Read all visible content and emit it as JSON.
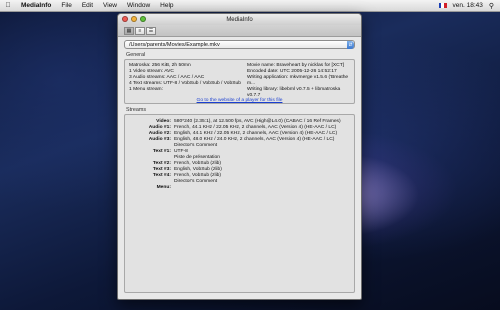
{
  "menubar": {
    "app_name": "MediaInfo",
    "items": [
      "File",
      "Edit",
      "View",
      "Window",
      "Help"
    ],
    "clock": "ven. 18:43",
    "flag_colors": [
      "#1a3fb5",
      "#ffffff",
      "#d2202a"
    ]
  },
  "window": {
    "title": "MediaInfo",
    "toolbar_icons": [
      "info-view-icon",
      "text-view-icon",
      "tree-view-icon"
    ],
    "file_path": "/Users/parents/Movies/Example.mkv",
    "general": {
      "section_label": "General",
      "left_lines": [
        "Matroska: 256 KiB, 2h 50mn",
        "1 Video stream: AVC",
        "3 Audio streams: AAC / AAC / AAC",
        "4 Text streams: UTF-8 / VobSub / VobSub / VobSub",
        "1 Menu stream:"
      ],
      "right_lines": [
        "Movie name: Braveheart by nicklas for [XCT]",
        "Encoded date: UTC 2005-12-26 14:52:17",
        "Writing application: mkvmerge v1.5.6 ('Breathe m...",
        "Writing library: libebml v0.7.5 + libmatroska v0.7.7"
      ],
      "link": "Go to the website of a player for this file"
    },
    "streams": {
      "section_label": "Streams",
      "rows": [
        {
          "key": "Video:",
          "value": "580*240 (2.35:1), at 12.500 fps, AVC (High@L4.0) (CABAC / 16 Ref Frames)"
        },
        {
          "key": "Audio #1:",
          "value": "French, 44.1 KHz / 22.05 KHz, 2 channels, AAC (Version 4) (HE-AAC / LC)"
        },
        {
          "key": "Audio #2:",
          "value": "English, 44.1 KHz / 22.05 KHz, 2 channels, AAC (Version 4) (HE-AAC / LC)"
        },
        {
          "key": "Audio #3:",
          "value": "English, 48.0 KHz / 24.0 KHz, 2 channels, AAC (Version 4) (HE-AAC / LC)"
        },
        {
          "key": "",
          "value": "Director's Comment"
        },
        {
          "key": "Text #1:",
          "value": "UTF-8"
        },
        {
          "key": "",
          "value": "Piste de présentation"
        },
        {
          "key": "Text #2:",
          "value": "French, VobSub (zlib)"
        },
        {
          "key": "Text #3:",
          "value": "English, VobSub (zlib)"
        },
        {
          "key": "Text #4:",
          "value": "French, VobSub (zlib)"
        },
        {
          "key": "",
          "value": "Director's Comment"
        },
        {
          "key": "Menu:",
          "value": ""
        }
      ]
    }
  }
}
